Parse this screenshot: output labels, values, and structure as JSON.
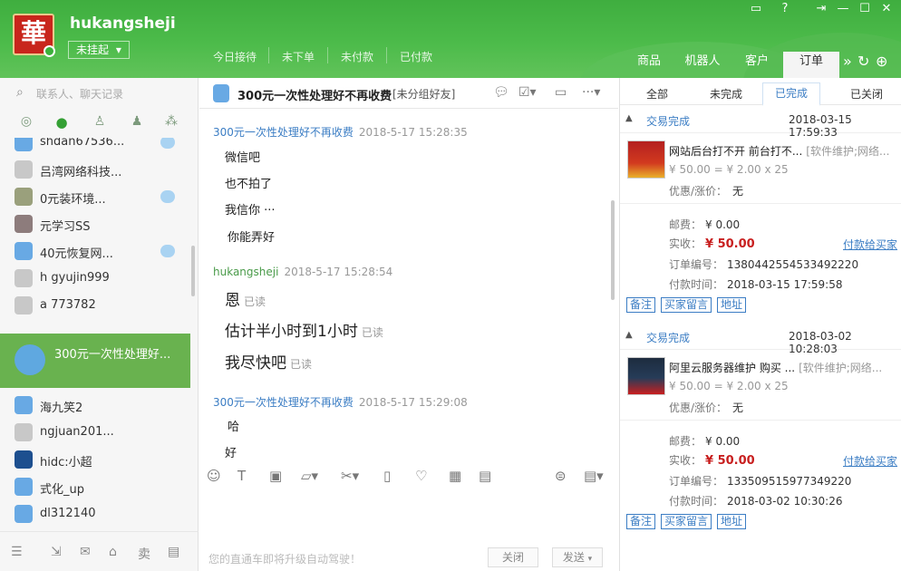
{
  "header": {
    "logo_char": "華",
    "username": "hukangsheji",
    "status": "未挂起",
    "stats": [
      "今日接待",
      "未下单",
      "未付款",
      "已付款"
    ],
    "tabs": [
      "商品",
      "机器人",
      "客户",
      "订单"
    ]
  },
  "left": {
    "search_placeholder": "联系人、聊天记录",
    "contacts": [
      {
        "name": "shdan67536...",
        "color": "#68a9e4",
        "badge": true
      },
      {
        "name": "吕湾网络科技...",
        "color": "#c8c8c8",
        "badge": false
      },
      {
        "name": "0元装环境...",
        "color": "#9aa07c",
        "badge": true
      },
      {
        "name": "元学习SS",
        "color": "#8d7c7c",
        "badge": false
      },
      {
        "name": "40元恢复网...",
        "color": "#68a9e4",
        "badge": true
      },
      {
        "name": "h  gyujin999",
        "color": "#c8c8c8",
        "badge": false
      },
      {
        "name": "a   773782",
        "color": "#c8c8c8",
        "badge": false
      },
      {
        "name": "300元一次性处理好...",
        "color": "#5fa8e0",
        "badge": false,
        "selected": true
      },
      {
        "name": "海九笑2",
        "color": "#68a9e4",
        "badge": false
      },
      {
        "name": "ngjuan201...",
        "color": "#c8c8c8",
        "badge": false
      },
      {
        "name": "hidc:小超",
        "color": "#1d4f8f",
        "badge": false
      },
      {
        "name": "式化_up",
        "color": "#68a9e4",
        "badge": false
      },
      {
        "name": "dl312140",
        "color": "#68a9e4",
        "badge": false
      }
    ]
  },
  "chat": {
    "name": "300元一次性处理好不再收费",
    "group": "[未分组好友]",
    "blocks": [
      {
        "who": "300元一次性处理好不再收费",
        "time": "2018-5-17 15:28:35",
        "me": false,
        "lines": [
          "微信吧",
          "也不拍了",
          "我信你 ···",
          "你能弄好"
        ]
      },
      {
        "who": "hukangsheji",
        "time": "2018-5-17 15:28:54",
        "me": true,
        "lines": [
          "恩",
          "估计半小时到1小时",
          "我尽快吧"
        ],
        "read": "已读"
      },
      {
        "who": "300元一次性处理好不再收费",
        "time": "2018-5-17 15:29:08",
        "me": false,
        "lines": [
          "哈",
          "好"
        ]
      }
    ],
    "hint": "您的直通车即将升级自动驾驶！",
    "close_btn": "关闭",
    "send_btn": "发送"
  },
  "orders": {
    "tabs": [
      "全部",
      "未完成",
      "已完成",
      "已关闭"
    ],
    "items": [
      {
        "state": "交易完成",
        "time": "2018-03-15 17:59:33",
        "title": "网站后台打不开 前台打不...",
        "category": "[软件维护;网络...",
        "price": "¥ 50.00 = ¥ 2.00 x 25",
        "discount_label": "优惠/涨价：",
        "discount": "无",
        "postage_label": "邮费：",
        "postage": "¥ 0.00",
        "paid_label": "实收：",
        "paid": "¥ 50.00",
        "pay_link": "付款给买家",
        "order_no_label": "订单编号：",
        "order_no": "1380442554533492220",
        "pay_time_label": "付款时间：",
        "pay_time": "2018-03-15 17:59:58",
        "buttons": [
          "备注",
          "买家留言",
          "地址"
        ]
      },
      {
        "state": "交易完成",
        "time": "2018-03-02 10:28:03",
        "title": "阿里云服务器维护 购买 ...",
        "category": "[软件维护;网络...",
        "price": "¥ 50.00 = ¥ 2.00 x 25",
        "discount_label": "优惠/涨价：",
        "discount": "无",
        "postage_label": "邮费：",
        "postage": "¥ 0.00",
        "paid_label": "实收：",
        "paid": "¥ 50.00",
        "pay_link": "付款给买家",
        "order_no_label": "订单编号：",
        "order_no": "133509515977349220",
        "pay_time_label": "付款时间：",
        "pay_time": "2018-03-02 10:30:26",
        "buttons": [
          "备注",
          "买家留言",
          "地址"
        ]
      }
    ]
  }
}
